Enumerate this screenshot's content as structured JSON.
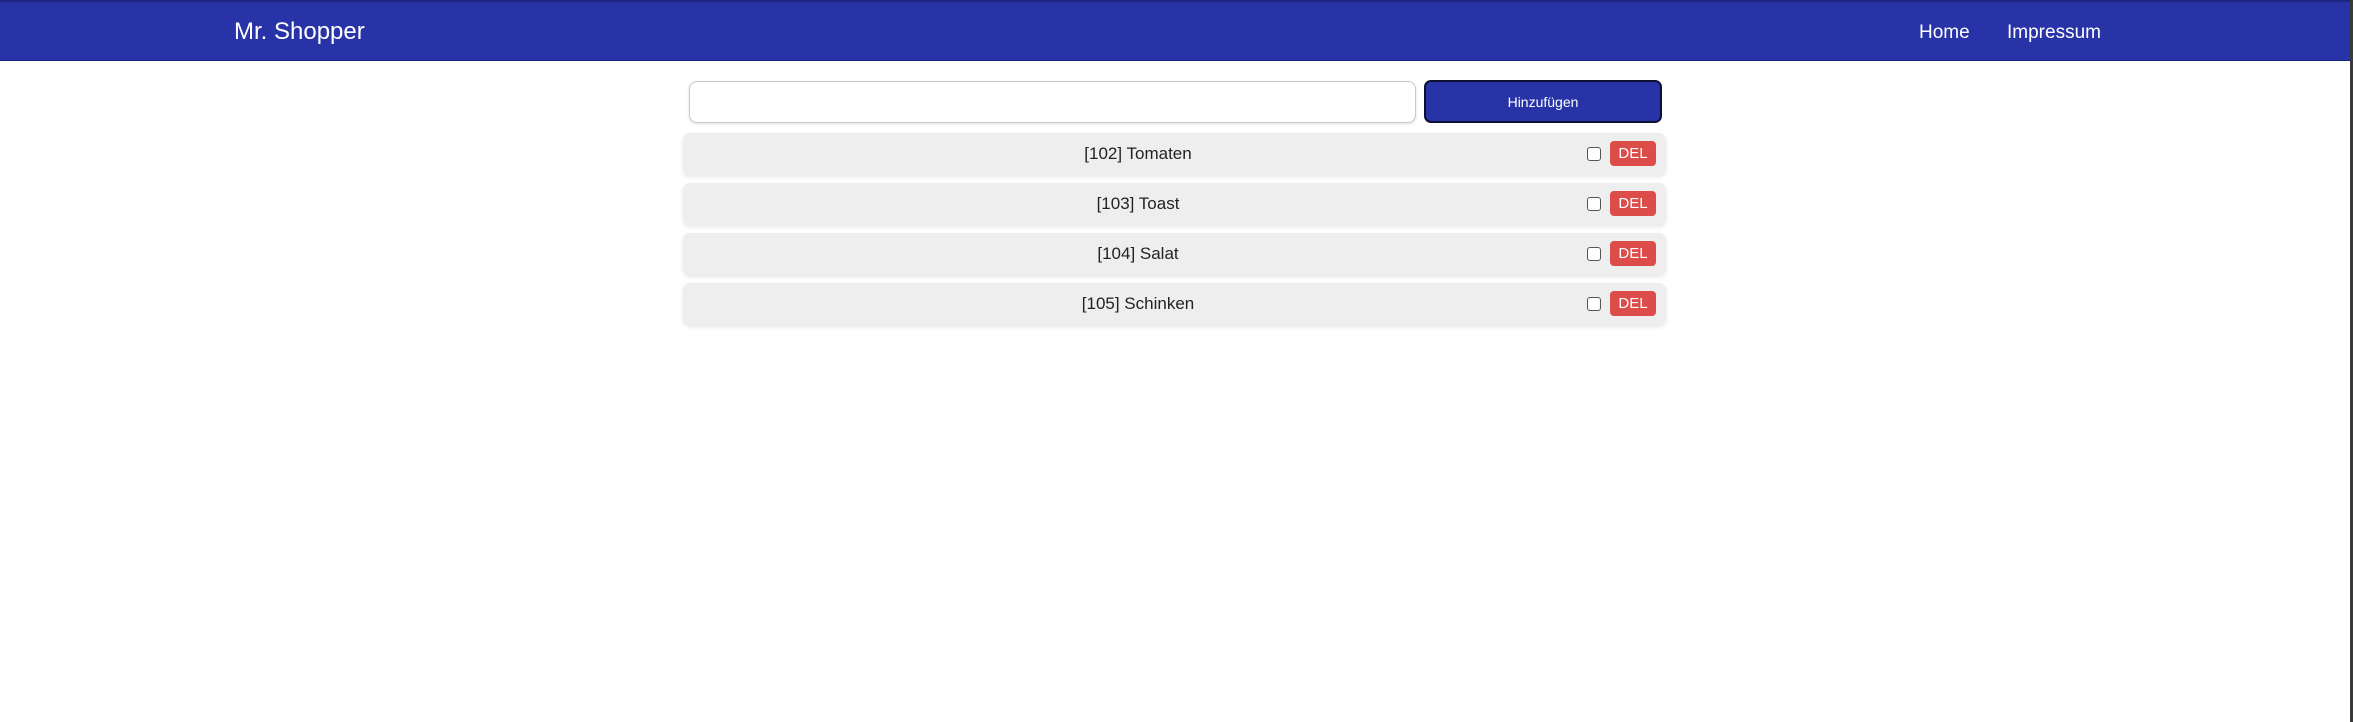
{
  "navbar": {
    "brand": "Mr. Shopper",
    "links": [
      "Home",
      "Impressum"
    ],
    "background_color": "#2833a8"
  },
  "add_form": {
    "input_value": "",
    "input_placeholder": "",
    "button_label": "Hinzufügen"
  },
  "items": [
    {
      "label": "[102] Tomaten",
      "checked": false,
      "delete_label": "DEL"
    },
    {
      "label": "[103] Toast",
      "checked": false,
      "delete_label": "DEL"
    },
    {
      "label": "[104] Salat",
      "checked": false,
      "delete_label": "DEL"
    },
    {
      "label": "[105] Schinken",
      "checked": false,
      "delete_label": "DEL"
    }
  ],
  "colors": {
    "accent": "#2833a8",
    "delete": "#dc4c48",
    "item_background": "#eeeeee"
  }
}
